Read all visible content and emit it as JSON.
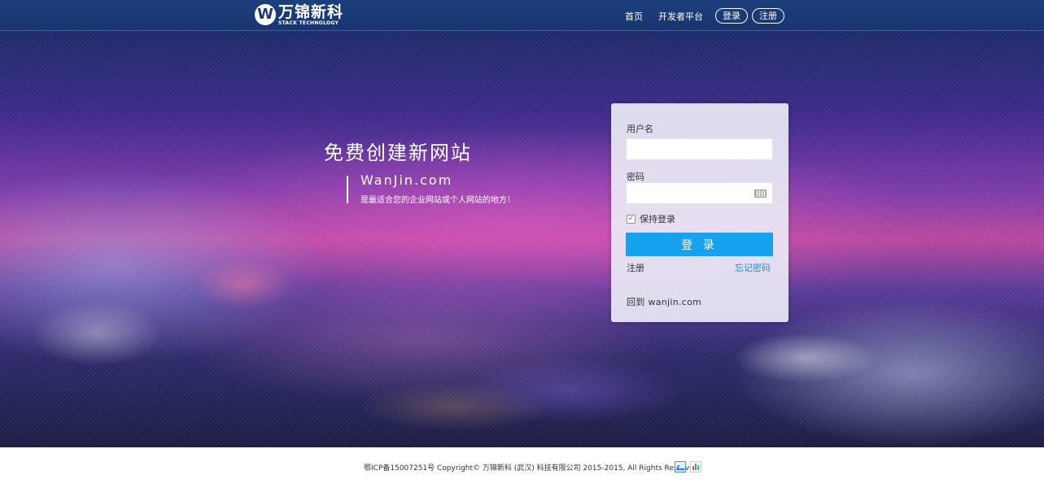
{
  "nav": {
    "logo_cn": "万锦新科",
    "logo_en": "STACK TECHNOLOGY",
    "logo_mark": "W",
    "links": [
      {
        "label": "首页"
      },
      {
        "label": "开发者平台"
      }
    ],
    "login_label": "登录",
    "register_label": "注册"
  },
  "hero": {
    "title": "免费创建新网站",
    "domain": "WanJin.com",
    "description": "是最适合您的企业网站或个人网站的地方！"
  },
  "login": {
    "username_label": "用户名",
    "username_value": "",
    "password_label": "密码",
    "password_value": "",
    "keyboard_icon": "keyboard-icon",
    "remember_label": "保持登录",
    "remember_checked": true,
    "submit_label": "登 录",
    "register_link": "注册",
    "forgot_link": "忘记密码",
    "back_link": "回到 wanjin.com"
  },
  "footer": {
    "text": "鄂ICP备15007251号  Copyright© 万锦新科 (武汉) 科技有限公司 2015-2015, All Rights Reserved.",
    "icons": [
      "stats-chart-icon",
      "bar-chart-icon"
    ]
  },
  "colors": {
    "nav_bg": "#1d3f7e",
    "primary_button": "#16a2ee",
    "link_blue": "#1e8fd6"
  }
}
